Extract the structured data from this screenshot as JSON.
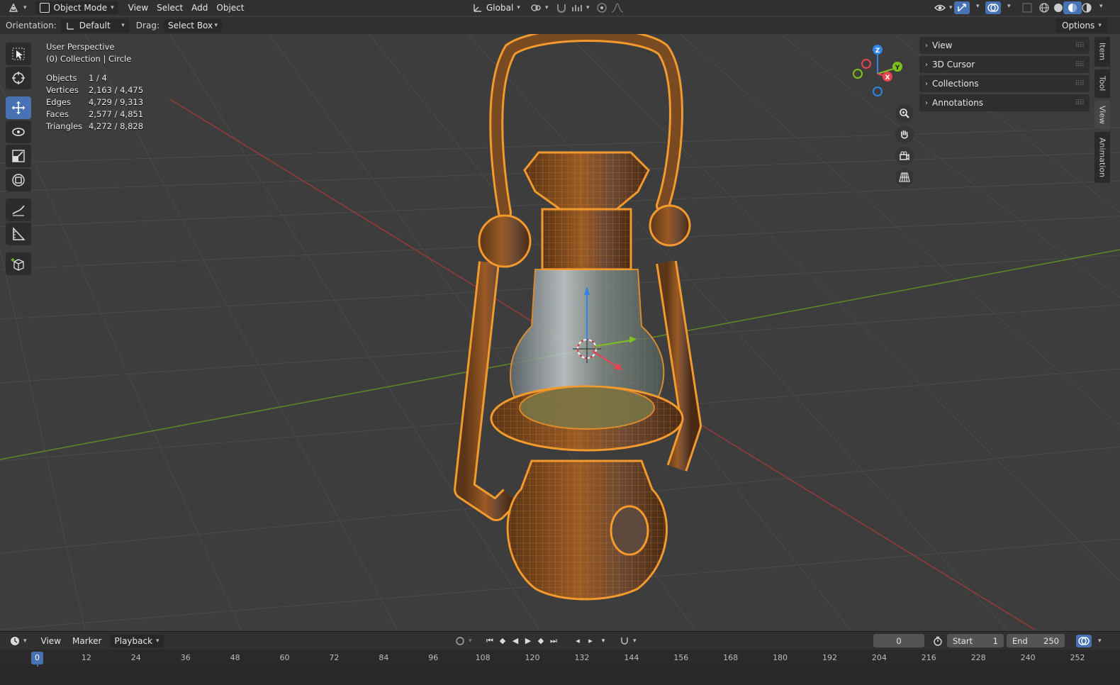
{
  "header": {
    "mode": "Object Mode",
    "menus": [
      "View",
      "Select",
      "Add",
      "Object"
    ],
    "transform_orientation": "Global"
  },
  "tool_settings": {
    "orientation_label": "Orientation:",
    "orientation_value": "Default",
    "drag_label": "Drag:",
    "drag_value": "Select Box",
    "options_label": "Options"
  },
  "viewport": {
    "perspective": "User Perspective",
    "collection": "(0) Collection | Circle",
    "stats": [
      {
        "label": "Objects",
        "value": "1 / 4"
      },
      {
        "label": "Vertices",
        "value": "2,163 / 4,475"
      },
      {
        "label": "Edges",
        "value": "4,729 / 9,313"
      },
      {
        "label": "Faces",
        "value": "2,577 / 4,851"
      },
      {
        "label": "Triangles",
        "value": "4,272 / 8,828"
      }
    ],
    "gizmo_axes": [
      "Z",
      "Y",
      "X"
    ]
  },
  "npanel": {
    "panels": [
      "View",
      "3D Cursor",
      "Collections",
      "Annotations"
    ],
    "tabs": [
      "Item",
      "Tool",
      "View",
      "Animation"
    ],
    "active_tab": "View"
  },
  "timeline": {
    "menus": [
      "View",
      "Marker",
      "Playback"
    ],
    "current_frame": "0",
    "start_label": "Start",
    "start_value": "1",
    "end_label": "End",
    "end_value": "250",
    "playhead": "0",
    "ticks": [
      "12",
      "24",
      "36",
      "48",
      "60",
      "72",
      "84",
      "96",
      "108",
      "120",
      "132",
      "144",
      "156",
      "168",
      "180",
      "192",
      "204",
      "216",
      "228",
      "240",
      "252"
    ]
  },
  "colors": {
    "selection": "#f29a2e",
    "accent": "#4772b3",
    "x_axis": "#e8434f",
    "y_axis": "#7cc21d",
    "z_axis": "#2f86e6"
  }
}
